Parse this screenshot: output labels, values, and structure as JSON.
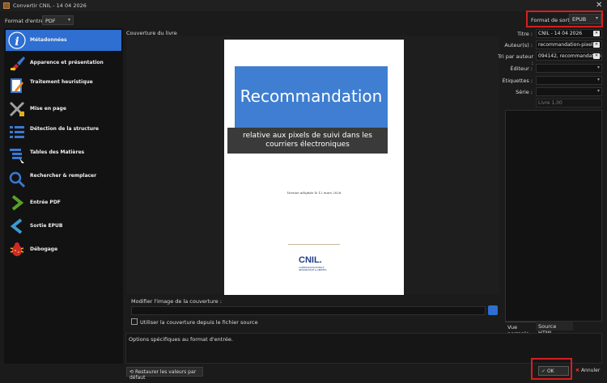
{
  "window": {
    "title": "Convertir CNIL - 14 04 2026",
    "close": "✕"
  },
  "input_format": {
    "label": "Format d'entrée:",
    "value": "PDF"
  },
  "output_format": {
    "label": "Format de sortie:",
    "value": "EPUB"
  },
  "sidebar": {
    "items": [
      {
        "label": "Métadonnées",
        "icon": "info-icon",
        "active": true
      },
      {
        "label": "Apparence et présentation",
        "icon": "brush-icon"
      },
      {
        "label": "Traitement heuristique",
        "icon": "notebook-pen-icon"
      },
      {
        "label": "Mise en page",
        "icon": "tools-icon"
      },
      {
        "label": "Détection de la structure",
        "icon": "list-icon"
      },
      {
        "label": "Tables des Matières",
        "icon": "toc-icon"
      },
      {
        "label": "Rechercher & remplacer",
        "icon": "search-icon"
      },
      {
        "label": "Entrée PDF",
        "icon": "arrow-right-icon"
      },
      {
        "label": "Sortie EPUB",
        "icon": "arrow-left-icon"
      },
      {
        "label": "Débogage",
        "icon": "bug-icon"
      }
    ]
  },
  "cover": {
    "label": "Couverture du livre",
    "title": "Recommandation",
    "subtitle_line1": "relative aux pixels de suivi dans les",
    "subtitle_line2": "courriers électroniques",
    "version": "Version adoptée le 12 mars 2026",
    "logo": "CNIL.",
    "logo_sub": "COMMISSION NATIONALE INFORMATIQUE & LIBERTÉS"
  },
  "modify_cover": {
    "label": "Modifier l'image de la couverture :",
    "value": ""
  },
  "use_source_cover": {
    "label": "Utiliser la couverture depuis le fichier source",
    "checked": false
  },
  "metadata": {
    "title_label": "Titre :",
    "title_value": "CNIL - 14 04 2026",
    "authors_label": "Auteur(s) :",
    "authors_value": "recommandation-pixel",
    "author_sort_label": "Tri par auteur :",
    "author_sort_value": "094142, recommandation",
    "publisher_label": "Éditeur :",
    "publisher_value": "",
    "tags_label": "Étiquettes :",
    "tags_value": "",
    "series_label": "Série :",
    "series_value": "",
    "series_number": "Livre 1,00"
  },
  "tabs": {
    "normal": "Vue normale",
    "html": "Source HTML"
  },
  "options": {
    "text": "Options spécifiques au format d'entrée."
  },
  "buttons": {
    "restore": "Restaurer les valeurs par défaut",
    "ok": "OK",
    "cancel": "Annuler"
  },
  "colors": {
    "accent": "#2e6fd1",
    "highlight": "#d32020",
    "cover_blue": "#3f7ed0"
  }
}
